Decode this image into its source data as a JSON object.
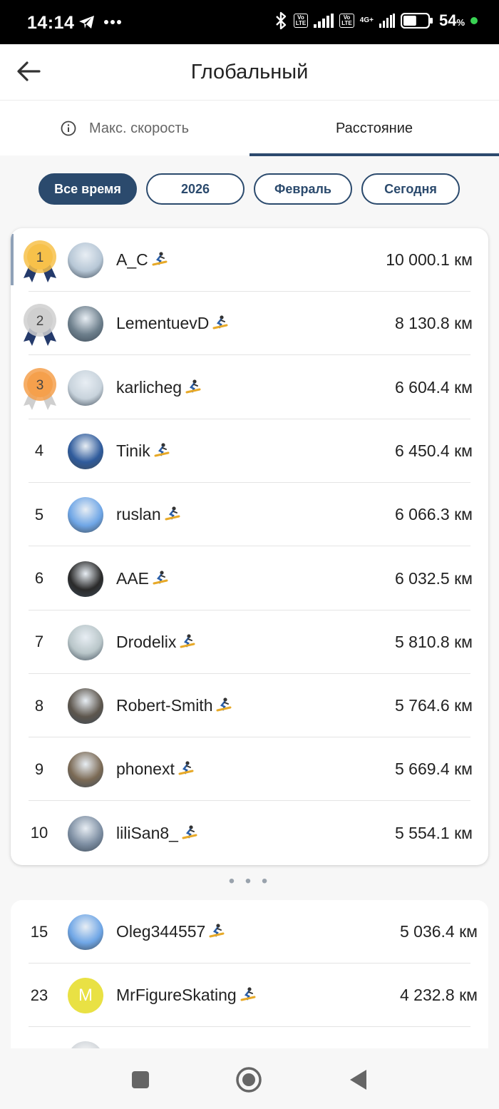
{
  "status_bar": {
    "time": "14:14",
    "battery_percent": "54",
    "battery_suffix": "%",
    "battery_level": 0.54,
    "icons": [
      "telegram-icon",
      "more-dots-icon",
      "bluetooth-icon",
      "volte-icon",
      "signal-icon",
      "4g-icon",
      "battery-icon"
    ],
    "volte_label": "Vo\nLTE",
    "net_label": "4G+"
  },
  "header": {
    "title": "Глобальный",
    "back_icon": "arrow-left-icon"
  },
  "tabs": [
    {
      "label": "Макс. скорость",
      "icon": "info-icon",
      "selected": false
    },
    {
      "label": "Расстояние",
      "selected": true
    }
  ],
  "filters": [
    {
      "label": "Все время",
      "selected": true
    },
    {
      "label": "2026",
      "selected": false
    },
    {
      "label": "Февраль",
      "selected": false
    },
    {
      "label": "Сегодня",
      "selected": false
    }
  ],
  "colors": {
    "accent": "#2b4a6d",
    "gold": "#f7c14a",
    "silver": "#cfcfcf",
    "bronze": "#f5a04c",
    "ribbon_dark": "#243a6b"
  },
  "top_list": [
    {
      "rank": "1",
      "medal": "gold",
      "name": "A_C",
      "distance": "10 000.1 км",
      "sport": "snowboard-icon",
      "highlight": true
    },
    {
      "rank": "2",
      "medal": "silver",
      "name": "LementuevD",
      "distance": "8 130.8 км",
      "sport": "snowboard-icon"
    },
    {
      "rank": "3",
      "medal": "bronze",
      "name": "karlicheg",
      "distance": "6 604.4 км",
      "sport": "snowboard-icon"
    },
    {
      "rank": "4",
      "name": "Tinik",
      "distance": "6 450.4 км",
      "sport": "snowboard-icon"
    },
    {
      "rank": "5",
      "name": "ruslan",
      "distance": "6 066.3 км",
      "sport": "snowboard-icon"
    },
    {
      "rank": "6",
      "name": "AAE",
      "distance": "6 032.5 км",
      "sport": "snowboard-icon"
    },
    {
      "rank": "7",
      "name": "Drodelix",
      "distance": "5 810.8 км",
      "sport": "snowboard-icon"
    },
    {
      "rank": "8",
      "name": "Robert-Smith",
      "distance": "5 764.6 км",
      "sport": "snowboard-icon"
    },
    {
      "rank": "9",
      "name": "phonext",
      "distance": "5 669.4 км",
      "sport": "snowboard-icon"
    },
    {
      "rank": "10",
      "name": "liliSan8_",
      "distance": "5 554.1 км",
      "sport": "snowboard-icon"
    }
  ],
  "separator": "• • •",
  "bottom_list": [
    {
      "rank": "15",
      "name": "Oleg344557",
      "distance": "5 036.4 км",
      "sport": "snowboard-icon"
    },
    {
      "rank": "23",
      "name": "MrFigureSkating",
      "distance": "4 232.8 км",
      "sport": "snowboard-icon",
      "avatar_letter": "M"
    }
  ],
  "nav_bar": {
    "buttons": [
      "recent-apps-square-icon",
      "home-circle-icon",
      "back-triangle-icon"
    ]
  }
}
